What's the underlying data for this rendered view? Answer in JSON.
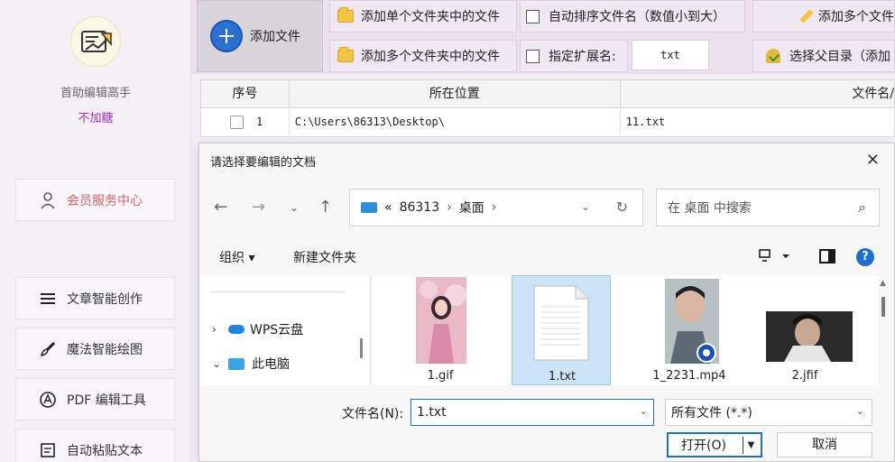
{
  "sidebar": {
    "app_name": "首助编辑高手",
    "app_sub": "不加糖",
    "member_center": "会员服务中心",
    "items": [
      {
        "label": "文章智能创作",
        "icon": "menu-lines-icon"
      },
      {
        "label": "魔法智能绘图",
        "icon": "brush-icon"
      },
      {
        "label": "PDF 编辑工具",
        "icon": "pdf-icon"
      },
      {
        "label": "自动粘贴文本",
        "icon": "paste-icon"
      }
    ]
  },
  "toolbar": {
    "add_file": "添加文件",
    "add_single_folder": "添加单个文件夹中的文件",
    "add_multi_folder": "添加多个文件夹中的文件",
    "auto_sort": "自动排序文件名（数值小到大）",
    "specify_ext": "指定扩展名:",
    "ext_value": "txt",
    "add_multi_right": "添加多个文件",
    "select_parent": "选择父目录（添加"
  },
  "table": {
    "headers": [
      "序号",
      "所在位置",
      "文件名/"
    ],
    "rows": [
      {
        "index": "1",
        "location": "C:\\Users\\86313\\Desktop\\",
        "filename": "11.txt"
      }
    ]
  },
  "dialog": {
    "title": "请选择要编辑的文档",
    "breadcrumb": [
      "86313",
      "桌面"
    ],
    "search_placeholder": "在 桌面 中搜索",
    "organize": "组织 ▾",
    "new_folder": "新建文件夹",
    "nav_items": [
      {
        "label": "WPS云盘",
        "arrow": "›"
      },
      {
        "label": "此电脑",
        "arrow": "⌄"
      }
    ],
    "files": [
      {
        "name": "1.gif"
      },
      {
        "name": "1.txt"
      },
      {
        "name": "1_2231.mp4"
      },
      {
        "name": "2.jfif"
      }
    ],
    "filename_label": "文件名(N):",
    "filename_value": "1.txt",
    "filetype_value": "所有文件 (*.*)",
    "open_label": "打开(O)",
    "cancel_label": "取消"
  },
  "colors": {
    "accent": "#1f6fd1",
    "brand_purple": "#9b34c8",
    "member_red": "#e06060"
  }
}
